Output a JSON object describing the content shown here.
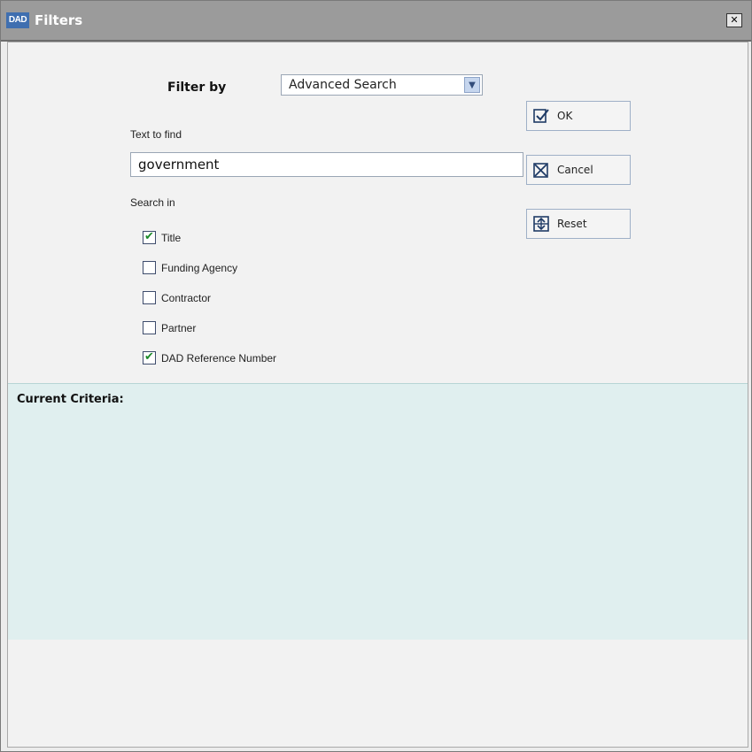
{
  "window": {
    "app_icon_text": "DAD",
    "title": "Filters",
    "close_label": "✕"
  },
  "filter": {
    "label": "Filter by",
    "selected": "Advanced Search"
  },
  "search": {
    "text_label": "Text to find",
    "text_value": "government",
    "search_in_label": "Search in",
    "options": [
      {
        "label": "Title",
        "checked": true
      },
      {
        "label": "Funding Agency",
        "checked": false
      },
      {
        "label": "Contractor",
        "checked": false
      },
      {
        "label": "Partner",
        "checked": false
      },
      {
        "label": "DAD Reference Number",
        "checked": true
      }
    ]
  },
  "buttons": {
    "ok": "OK",
    "cancel": "Cancel",
    "reset": "Reset"
  },
  "criteria": {
    "title": "Current Criteria:"
  },
  "colors": {
    "titlebar": "#9b9b9b",
    "criteria_bg": "#e0efef",
    "check": "#1d8a2a"
  }
}
